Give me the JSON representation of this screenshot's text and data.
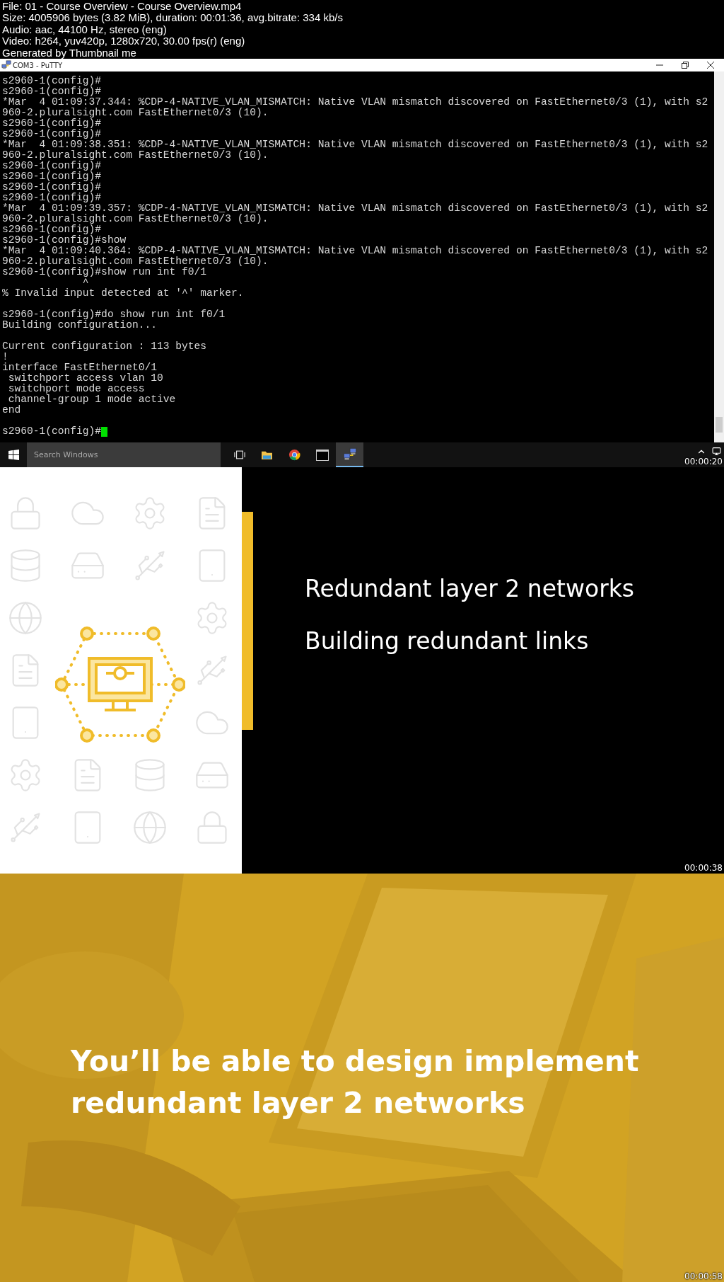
{
  "header": {
    "lines": [
      "File: 01 - Course Overview - Course Overview.mp4",
      "Size: 4005906 bytes (3.82 MiB), duration: 00:01:36, avg.bitrate: 334 kb/s",
      "Audio: aac, 44100 Hz, stereo (eng)",
      "Video: h264, yuv420p, 1280x720, 30.00 fps(r) (eng)",
      "Generated by Thumbnail me"
    ]
  },
  "frames": [
    {
      "kind": "terminal",
      "timestamp": "00:00:20",
      "window": {
        "title": "COM3 - PuTTY"
      },
      "blocks": [
        [
          "s2960-1(config)#",
          "s2960-1(config)#",
          "*Mar  4 01:09:37.344: %CDP-4-NATIVE_VLAN_MISMATCH: Native VLAN mismatch discovered on FastEthernet0/3 (1), with s2",
          "960-2.pluralsight.com FastEthernet0/3 (10).",
          "s2960-1(config)#",
          "s2960-1(config)#",
          "*Mar  4 01:09:38.351: %CDP-4-NATIVE_VLAN_MISMATCH: Native VLAN mismatch discovered on FastEthernet0/3 (1), with s2",
          "960-2.pluralsight.com FastEthernet0/3 (10).",
          "s2960-1(config)#",
          "s2960-1(config)#",
          "s2960-1(config)#",
          "s2960-1(config)#",
          "*Mar  4 01:09:39.357: %CDP-4-NATIVE_VLAN_MISMATCH: Native VLAN mismatch discovered on FastEthernet0/3 (1), with s2",
          "960-2.pluralsight.com FastEthernet0/3 (10).",
          "s2960-1(config)#",
          "s2960-1(config)#show",
          "*Mar  4 01:09:40.364: %CDP-4-NATIVE_VLAN_MISMATCH: Native VLAN mismatch discovered on FastEthernet0/3 (1), with s2",
          "960-2.pluralsight.com FastEthernet0/3 (10).",
          "s2960-1(config)#show run int f0/1",
          "             ^",
          "% Invalid input detected at '^' marker."
        ],
        [
          "s2960-1(config)#do show run int f0/1",
          "Building configuration..."
        ],
        [
          "Current configuration : 113 bytes",
          "!",
          "interface FastEthernet0/1",
          " switchport access vlan 10",
          " switchport mode access",
          " channel-group 1 mode active",
          "end"
        ],
        [
          "s2960-1(config)#"
        ]
      ],
      "taskbar": {
        "search": {
          "placeholder": "Search Windows"
        },
        "apps": [
          {
            "kind": "task-view",
            "selected": false
          },
          {
            "kind": "folder",
            "selected": false
          },
          {
            "kind": "browser",
            "selected": false
          },
          {
            "kind": "console",
            "selected": false
          },
          {
            "kind": "putty",
            "selected": true
          }
        ]
      }
    },
    {
      "kind": "slide",
      "timestamp": "00:00:38",
      "items": [
        "Redundant layer 2 networks",
        "Building redundant links"
      ]
    },
    {
      "timestamp": "00:00:58",
      "caption_lines": [
        "You’ll be able to design implement",
        "redundant layer 2 networks"
      ]
    }
  ]
}
